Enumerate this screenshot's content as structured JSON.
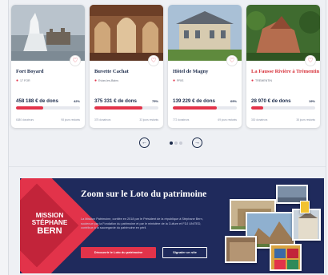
{
  "cards": [
    {
      "title": "Fort Boyard",
      "location": "17 FOR",
      "amount": "458 188 € de dons",
      "percent": "42%",
      "progress": 0.42,
      "stats_left": "6380 donateurs",
      "stats_right": "98 jours restants",
      "title_color": "#1b2a4a"
    },
    {
      "title": "Buvette Cachat",
      "location": "Evian-les-Bains",
      "amount": "375 331 € de dons",
      "percent": "75%",
      "progress": 0.75,
      "stats_left": "375 donateurs",
      "stats_right": "33 jours restants",
      "title_color": "#1b2a4a"
    },
    {
      "title": "Hôtel de Magny",
      "location": "PRIS",
      "amount": "139 229 € de dons",
      "percent": "69%",
      "progress": 0.69,
      "stats_left": "772 donateurs",
      "stats_right": "69 jours restants",
      "title_color": "#1b2a4a"
    },
    {
      "title": "La Fausse Rivière à Trémentin",
      "location": "TREMENTIN",
      "amount": "28 970 € de dons",
      "percent": "19%",
      "progress": 0.19,
      "stats_left": "330 donateurs",
      "stats_right": "38 jours restants",
      "title_color": "#d62e37"
    }
  ],
  "carousel": {
    "prev_icon": "arrow-left-icon",
    "next_icon": "arrow-right-icon",
    "prev_glyph": "←",
    "next_glyph": "→",
    "active_index": 0,
    "dot_count": 3
  },
  "banner": {
    "logo_line1": "MISSION",
    "logo_line2": "STÉPHANE",
    "logo_line3": "BERN",
    "headline": "Zoom sur le Loto du patrimoine",
    "description": "La Mission Patrimoine, confiée en 2018 par le Président de la république à Stéphane Bern, soutenue par la Fondation du patrimoine et par le ministère de la Culture et FDJ UNITED, contribue à la sauvegarde du patrimoine en péril.",
    "primary_button": "Découvrir le Loto du patrimoine",
    "secondary_button": "Signaler un site"
  },
  "colors": {
    "accent": "#e2334a",
    "navy": "#1f2a5c",
    "text_dark": "#1b2a4a"
  },
  "heart_glyph": "♡",
  "pin_glyph": "●"
}
